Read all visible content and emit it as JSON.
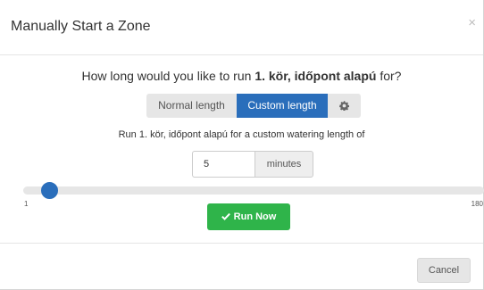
{
  "dialog": {
    "title": "Manually Start a Zone",
    "close_label": "×"
  },
  "question": {
    "prefix": "How long would you like to run ",
    "zone_name": "1. kör, időpont alapú",
    "suffix": " for?"
  },
  "mode": {
    "normal_label": "Normal length",
    "custom_label": "Custom length",
    "selected": "Custom length",
    "settings_icon": "gear-icon"
  },
  "description": "Run 1. kör, időpont alapú for a custom watering length of",
  "duration": {
    "value": "5",
    "unit": "minutes"
  },
  "slider": {
    "min": 1,
    "max": 180,
    "value": 5,
    "min_label": "1",
    "max_label": "180"
  },
  "run_button": {
    "label": "Run Now",
    "icon": "check-icon"
  },
  "footer": {
    "cancel_label": "Cancel"
  },
  "colors": {
    "primary": "#2a6ebb",
    "success": "#2fb44a",
    "neutral": "#e6e6e6"
  }
}
